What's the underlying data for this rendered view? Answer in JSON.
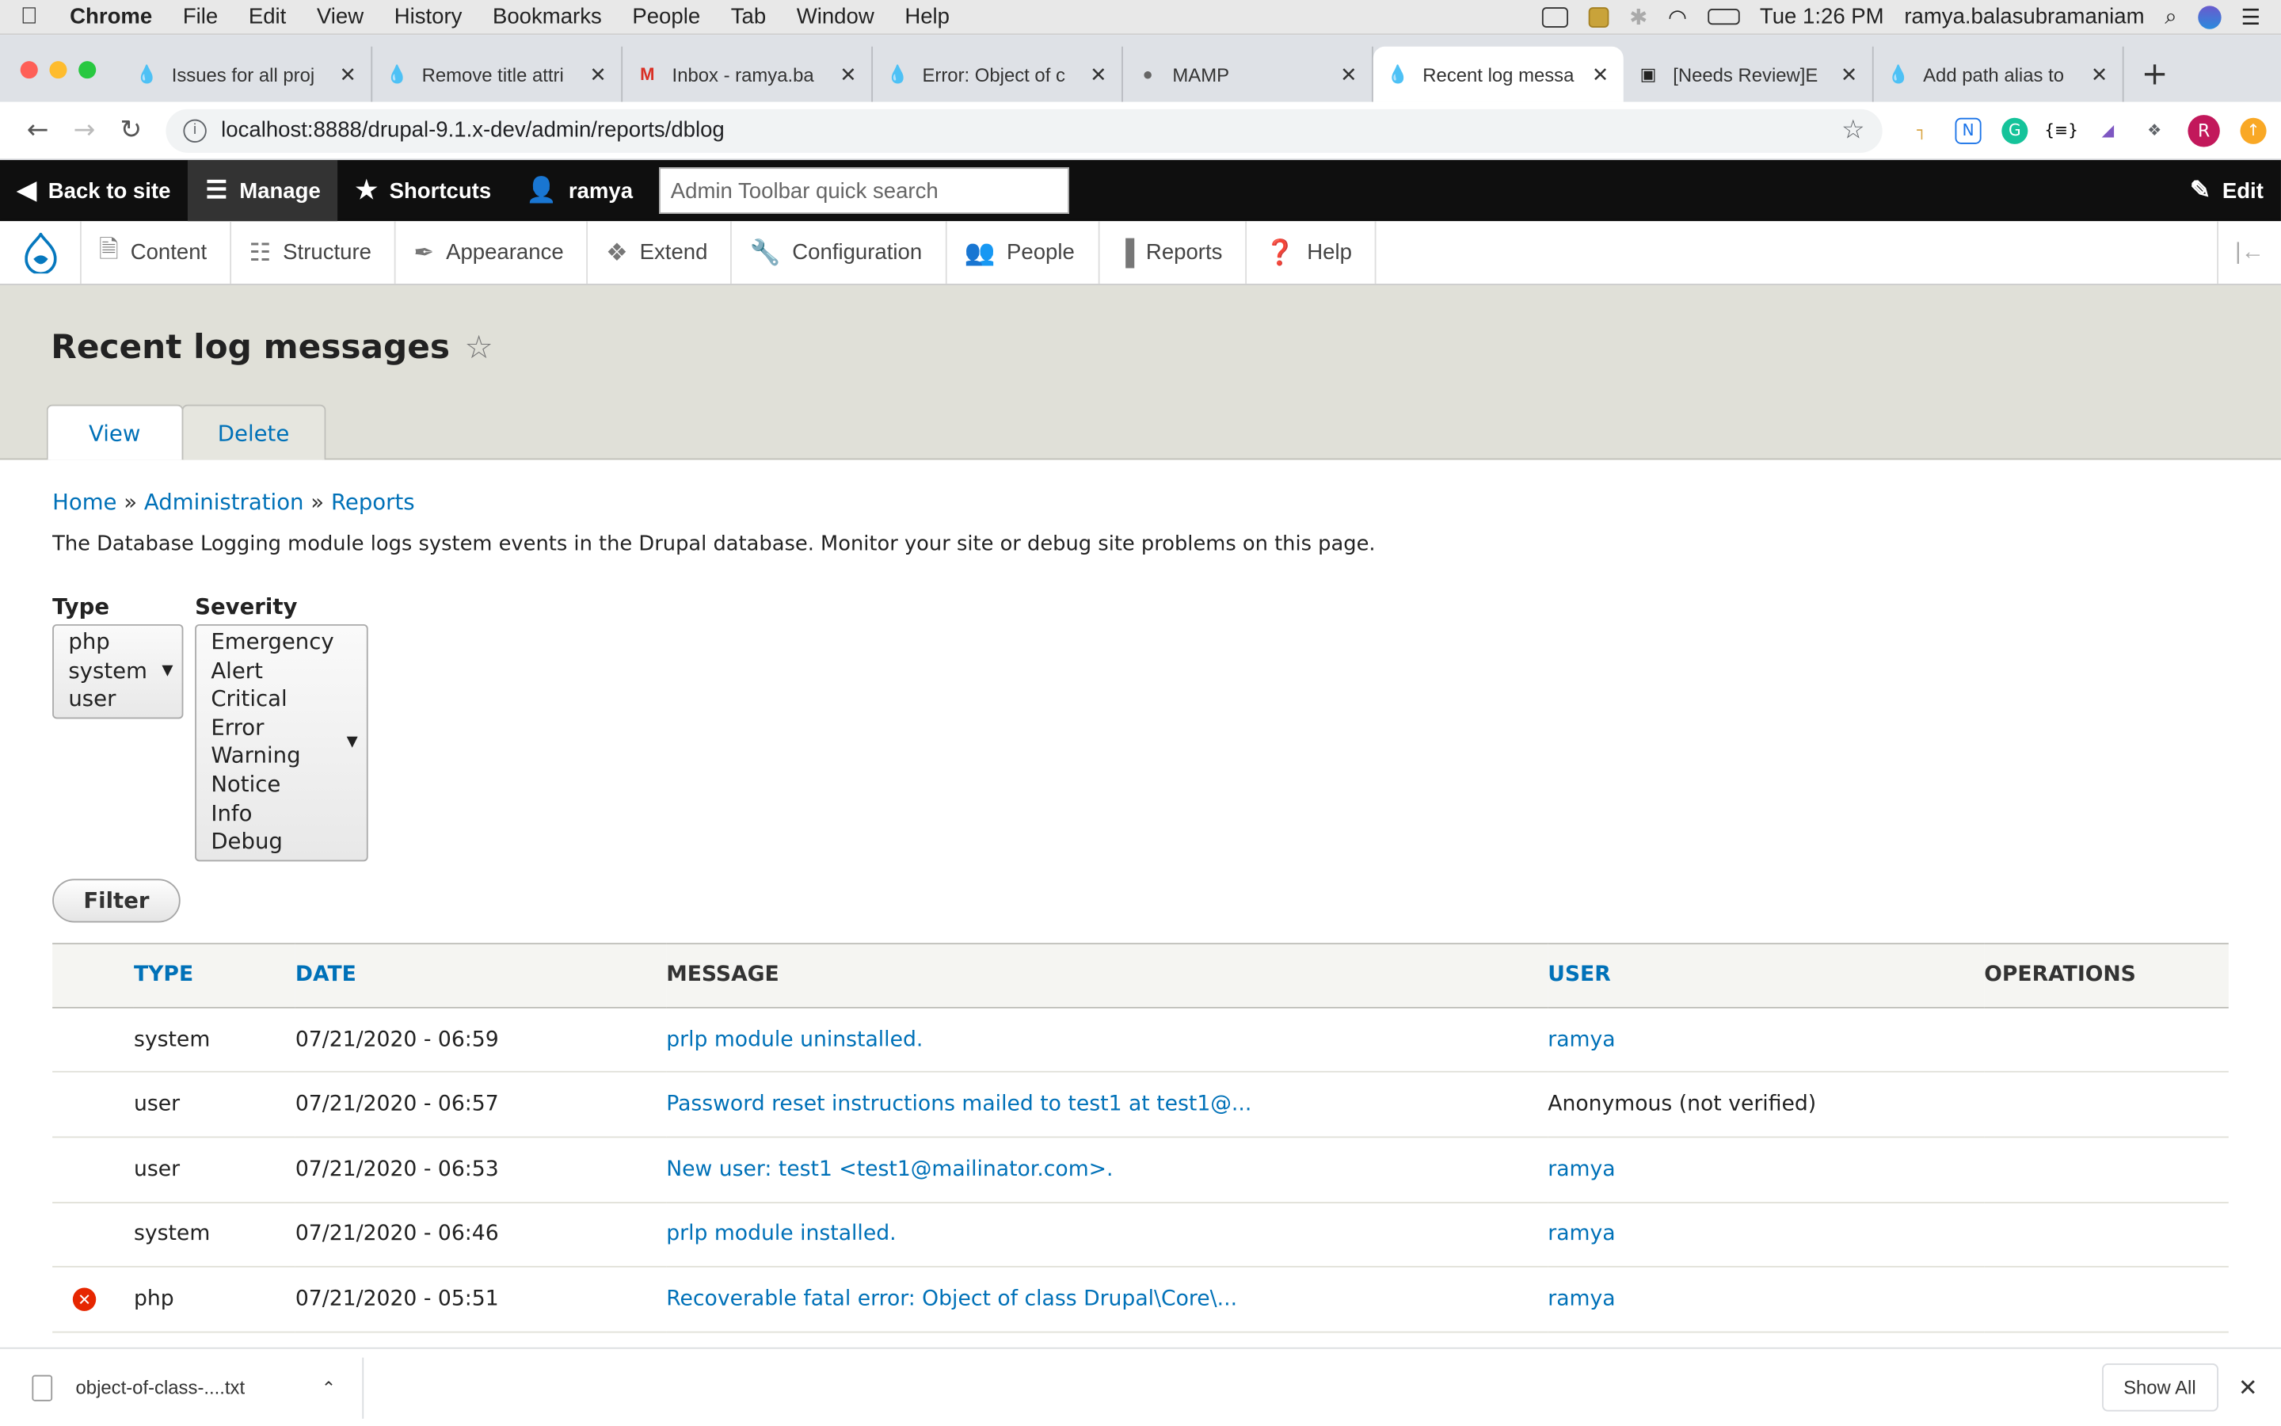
{
  "menubar": {
    "app": "Chrome",
    "items": [
      "File",
      "Edit",
      "View",
      "History",
      "Bookmarks",
      "People",
      "Tab",
      "Window",
      "Help"
    ],
    "clock": "Tue 1:26 PM",
    "user": "ramya.balasubramaniam"
  },
  "tabs": [
    {
      "title": "Issues for all proj",
      "icon": "drupal-drop-icon"
    },
    {
      "title": "Remove title attri",
      "icon": "drupal-drop-icon"
    },
    {
      "title": "Inbox - ramya.ba",
      "icon": "gmail-icon"
    },
    {
      "title": "Error: Object of c",
      "icon": "drupal-drop-icon"
    },
    {
      "title": "MAMP",
      "icon": "mamp-icon"
    },
    {
      "title": "Recent log messa",
      "icon": "drupal-drop-icon"
    },
    {
      "title": "[Needs Review]E",
      "icon": "trello-icon"
    },
    {
      "title": "Add path alias to",
      "icon": "drupal-drop-icon"
    }
  ],
  "address": {
    "url": "localhost:8888/drupal-9.1.x-dev/admin/reports/dblog"
  },
  "admin_toolbar": {
    "back": "Back to site",
    "manage": "Manage",
    "shortcuts": "Shortcuts",
    "user": "ramya",
    "search_placeholder": "Admin Toolbar quick search",
    "edit": "Edit"
  },
  "tray": {
    "items": [
      "Content",
      "Structure",
      "Appearance",
      "Extend",
      "Configuration",
      "People",
      "Reports",
      "Help"
    ]
  },
  "page": {
    "title": "Recent log messages",
    "tabs": [
      "View",
      "Delete"
    ],
    "breadcrumb": [
      "Home",
      "Administration",
      "Reports"
    ],
    "breadcrumb_sep": "»",
    "description": "The Database Logging module logs system events in the Drupal database. Monitor your site or debug site problems on this page."
  },
  "filters": {
    "type_label": "Type",
    "type_options": [
      "php",
      "system",
      "user"
    ],
    "severity_label": "Severity",
    "severity_options": [
      "Emergency",
      "Alert",
      "Critical",
      "Error",
      "Warning",
      "Notice",
      "Info",
      "Debug"
    ],
    "button": "Filter"
  },
  "table": {
    "headers": {
      "type": "Type",
      "date": "Date",
      "message": "Message",
      "user": "User",
      "operations": "Operations"
    },
    "rows": [
      {
        "type": "system",
        "date": "07/21/2020 - 06:59",
        "message": "prlp module uninstalled.",
        "user": "ramya",
        "user_link": true,
        "error": false
      },
      {
        "type": "user",
        "date": "07/21/2020 - 06:57",
        "message": "Password reset instructions mailed to test1 at test1@...",
        "user": "Anonymous (not verified)",
        "user_link": false,
        "error": false
      },
      {
        "type": "user",
        "date": "07/21/2020 - 06:53",
        "message": "New user: test1 <test1@mailinator.com>.",
        "user": "ramya",
        "user_link": true,
        "error": false
      },
      {
        "type": "system",
        "date": "07/21/2020 - 06:46",
        "message": "prlp module installed.",
        "user": "ramya",
        "user_link": true,
        "error": false
      },
      {
        "type": "php",
        "date": "07/21/2020 - 05:51",
        "message": "Recoverable fatal error: Object of class Drupal\\Core\\...",
        "user": "ramya",
        "user_link": true,
        "error": true
      }
    ]
  },
  "downloads": {
    "file": "object-of-class-....txt",
    "show_all": "Show All"
  },
  "colors": {
    "link": "#0071b8",
    "admin_bar": "#0f0f0f",
    "header_bg": "#e0e0d8",
    "error": "#e62600"
  }
}
